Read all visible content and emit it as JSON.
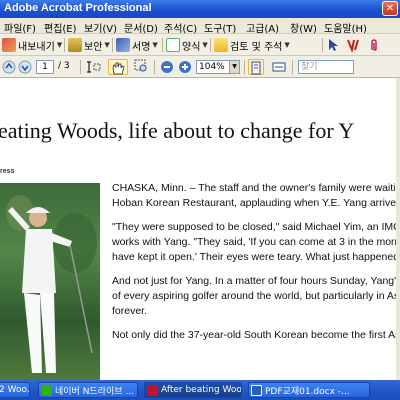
{
  "window": {
    "title": "Adobe Acrobat Professional",
    "close_glyph": "✕"
  },
  "menu": [
    "파일(F)",
    "편집(E)",
    "보기(V)",
    "문서(D)",
    "주석(C)",
    "도구(T)",
    "고급(A)",
    "창(W)",
    "도움말(H)"
  ],
  "toolbar1": {
    "export_label": "내보내기",
    "security_label": "보안",
    "sign_label": "서명",
    "forms_label": "양식",
    "review_label": "검토 및 주석"
  },
  "toolbar2": {
    "page_number": "1",
    "page_total": "/ 3",
    "zoom": "104%",
    "find_placeholder": "찾기"
  },
  "document": {
    "headline": "eating Woods, life about to change for Y",
    "credit": "ress",
    "paragraphs": [
      [
        "CHASKA, Minn. – The staff and the owner's family were waitin",
        "Hoban Korean Restaurant, applauding when Y.E. Yang arrive"
      ],
      [
        "\"They were supposed to be closed,\" said Michael Yim, an IMG",
        "works with Yang. \"They said, 'If you can come at 3 in the morn",
        "have kept it open.' Their eyes were teary. What just happened"
      ],
      [
        "And not just for Yang. In a matter of four hours Sunday, Yang'",
        "of every aspiring golfer around the world, but particularly in As",
        "forever."
      ],
      [
        "Not only did the 37-year-old South Korean become the first As"
      ]
    ]
  },
  "taskbar": {
    "items": [
      "2 Woo...",
      "네이버 N드라이브 ...",
      "After beating Woo...",
      "PDF교재01.docx -..."
    ]
  },
  "colors": {
    "titlebar": "#1c4fd0",
    "taskbar": "#2257c8",
    "menubar": "#ece9d8"
  }
}
